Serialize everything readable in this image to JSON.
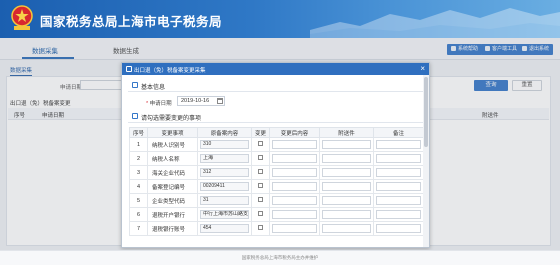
{
  "header": {
    "title": "国家税务总局上海市电子税务局"
  },
  "tabs": [
    {
      "label": "数据采集",
      "active": true
    },
    {
      "label": "数据生成",
      "active": false
    }
  ],
  "toolbar": [
    {
      "label": "系统帮助",
      "icon": "help-icon"
    },
    {
      "label": "客户端工具",
      "icon": "tool-icon"
    },
    {
      "label": "退出系统",
      "icon": "exit-icon"
    }
  ],
  "background": {
    "breadcrumb": "数据采集",
    "filter_label": "申请日期",
    "query_button": "查询",
    "reset_button": "重置",
    "section_title": "出口退（免）税备案变更",
    "columns": {
      "seq": "序号",
      "date": "申请日期",
      "attachment": "附送件"
    }
  },
  "modal": {
    "title": "出口退（免）税备案变更采集",
    "basic_section": "基本信息",
    "date_label": "申请日期",
    "date_value": "2019-10-16",
    "items_section": "请勾选需要变更的事项",
    "columns": [
      "序号",
      "变更事项",
      "原备案内容",
      "变更",
      "变更后内容",
      "附送件",
      "备注"
    ],
    "rows": [
      {
        "seq": "1",
        "item": "纳税人识别号",
        "original": "310"
      },
      {
        "seq": "2",
        "item": "纳税人名称",
        "original": "上海"
      },
      {
        "seq": "3",
        "item": "海关企业代码",
        "original": "312"
      },
      {
        "seq": "4",
        "item": "备案登记编号",
        "original": "00209411"
      },
      {
        "seq": "5",
        "item": "企业类型代码",
        "original": "31"
      },
      {
        "seq": "6",
        "item": "退税开户银行",
        "original": "中行上海市苏山路支行"
      },
      {
        "seq": "7",
        "item": "退税银行账号",
        "original": "454"
      }
    ]
  },
  "footer": {
    "text": "国家税务总局上海市税务局主办并维护"
  },
  "colors": {
    "brand": "#2f6fbf",
    "accent": "#3577c8"
  }
}
